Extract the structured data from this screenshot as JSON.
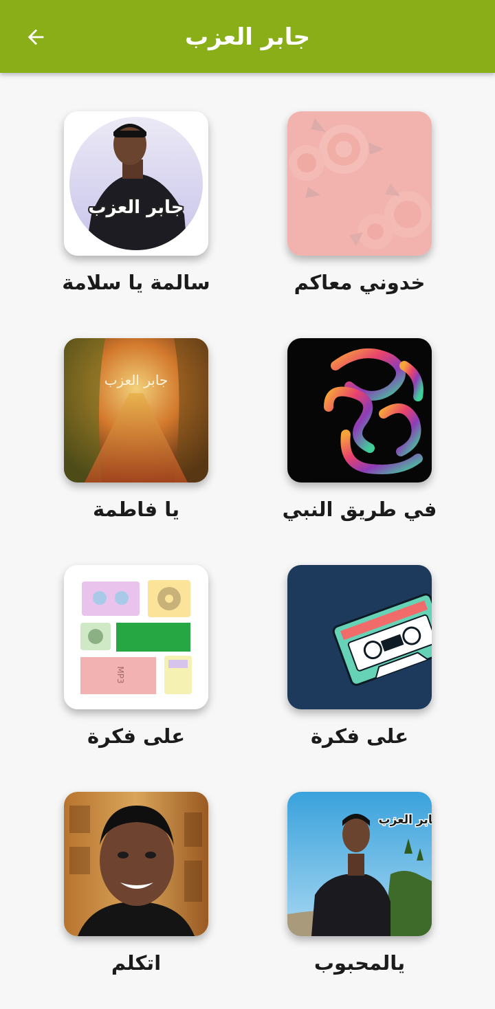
{
  "header": {
    "title": "جابر العزب",
    "back_icon": "arrow-left-icon",
    "background": "#8aae17"
  },
  "albums": [
    {
      "label": "خدوني معاكم",
      "art": "pink-roses-cover"
    },
    {
      "label": "سالمة يا سلامة",
      "art": "singer-portrait-circle-cover",
      "art_text": "جابر العزب"
    },
    {
      "label": "في طريق النبي",
      "art": "colorful-calligraphy-cover"
    },
    {
      "label": "يا فاطمة",
      "art": "autumn-path-cover",
      "art_text": "جابر العزب"
    },
    {
      "label": "على فكرة",
      "art": "cassette-tape-cover"
    },
    {
      "label": "على فكرة",
      "art": "retro-audio-collage-cover",
      "art_text": "MP3"
    },
    {
      "label": "يالمحبوب",
      "art": "singer-outdoor-cover",
      "art_text": "جابر العزب"
    },
    {
      "label": "اتكلم",
      "art": "singer-closeup-cover"
    }
  ]
}
